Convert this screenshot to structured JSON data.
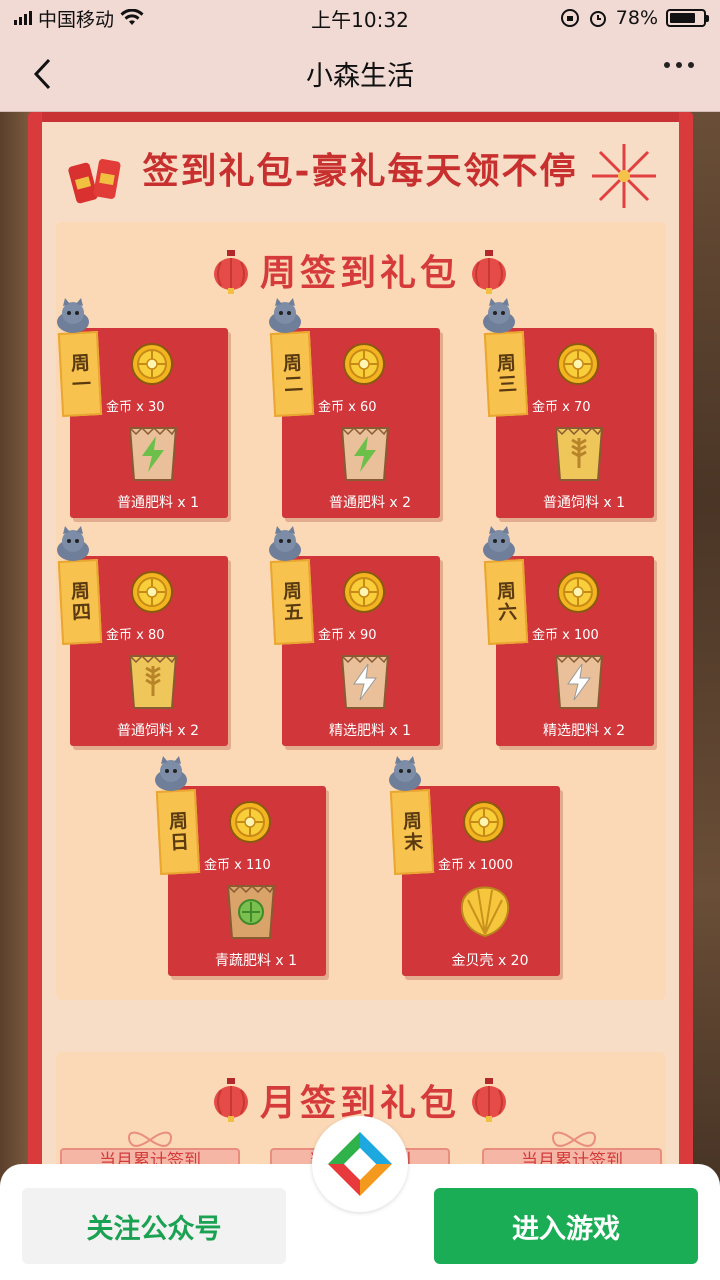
{
  "status_bar": {
    "carrier": "中国移动",
    "time": "上午10:32",
    "battery": "78%",
    "battery_level": 0.78
  },
  "nav": {
    "title": "小森生活"
  },
  "poster": {
    "title": "签到礼包-豪礼每天领不停",
    "weekly_section_title": "周签到礼包",
    "monthly_section_title": "月签到礼包",
    "days": [
      {
        "day": "周一",
        "coin_label": "金币 x 30",
        "item_label": "普通肥料 x 1",
        "item_icon": "fertilizer-green-bag-icon"
      },
      {
        "day": "周二",
        "coin_label": "金币 x 60",
        "item_label": "普通肥料 x 2",
        "item_icon": "fertilizer-green-bag-icon"
      },
      {
        "day": "周三",
        "coin_label": "金币 x 70",
        "item_label": "普通饲料 x 1",
        "item_icon": "feed-bag-icon"
      },
      {
        "day": "周四",
        "coin_label": "金币 x 80",
        "item_label": "普通饲料 x 2",
        "item_icon": "feed-bag-icon"
      },
      {
        "day": "周五",
        "coin_label": "金币 x 90",
        "item_label": "精选肥料 x 1",
        "item_icon": "fertilizer-white-bag-icon"
      },
      {
        "day": "周六",
        "coin_label": "金币 x 100",
        "item_label": "精选肥料 x 2",
        "item_icon": "fertilizer-white-bag-icon"
      },
      {
        "day": "周日",
        "coin_label": "金币 x 110",
        "item_label": "青蔬肥料 x 1",
        "item_icon": "vegetable-fertilizer-bag-icon"
      },
      {
        "day": "周末",
        "coin_label": "金币 x 1000",
        "item_label": "金贝壳 x 20",
        "item_icon": "golden-shell-icon"
      }
    ],
    "monthly_chips": [
      "当月累计签到",
      "当月累计签到",
      "当月累计签到"
    ]
  },
  "actions": {
    "follow_label": "关注公众号",
    "enter_label": "进入游戏"
  },
  "colors": {
    "accent_red": "#d0363a",
    "tag_yellow": "#f7c24e",
    "green": "#1aad55"
  }
}
